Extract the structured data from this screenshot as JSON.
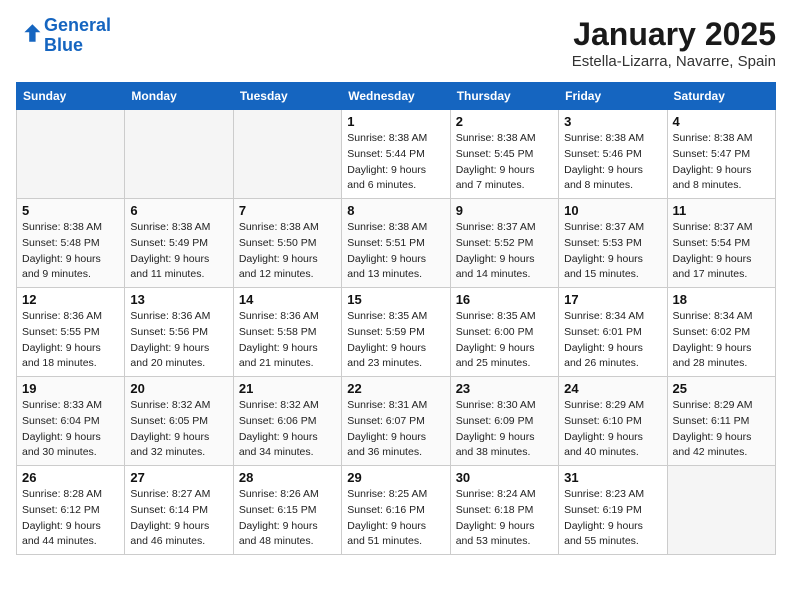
{
  "header": {
    "logo_line1": "General",
    "logo_line2": "Blue",
    "title": "January 2025",
    "subtitle": "Estella-Lizarra, Navarre, Spain"
  },
  "weekdays": [
    "Sunday",
    "Monday",
    "Tuesday",
    "Wednesday",
    "Thursday",
    "Friday",
    "Saturday"
  ],
  "weeks": [
    [
      {
        "day": "",
        "info": ""
      },
      {
        "day": "",
        "info": ""
      },
      {
        "day": "",
        "info": ""
      },
      {
        "day": "1",
        "info": "Sunrise: 8:38 AM\nSunset: 5:44 PM\nDaylight: 9 hours and 6 minutes."
      },
      {
        "day": "2",
        "info": "Sunrise: 8:38 AM\nSunset: 5:45 PM\nDaylight: 9 hours and 7 minutes."
      },
      {
        "day": "3",
        "info": "Sunrise: 8:38 AM\nSunset: 5:46 PM\nDaylight: 9 hours and 8 minutes."
      },
      {
        "day": "4",
        "info": "Sunrise: 8:38 AM\nSunset: 5:47 PM\nDaylight: 9 hours and 8 minutes."
      }
    ],
    [
      {
        "day": "5",
        "info": "Sunrise: 8:38 AM\nSunset: 5:48 PM\nDaylight: 9 hours and 9 minutes."
      },
      {
        "day": "6",
        "info": "Sunrise: 8:38 AM\nSunset: 5:49 PM\nDaylight: 9 hours and 11 minutes."
      },
      {
        "day": "7",
        "info": "Sunrise: 8:38 AM\nSunset: 5:50 PM\nDaylight: 9 hours and 12 minutes."
      },
      {
        "day": "8",
        "info": "Sunrise: 8:38 AM\nSunset: 5:51 PM\nDaylight: 9 hours and 13 minutes."
      },
      {
        "day": "9",
        "info": "Sunrise: 8:37 AM\nSunset: 5:52 PM\nDaylight: 9 hours and 14 minutes."
      },
      {
        "day": "10",
        "info": "Sunrise: 8:37 AM\nSunset: 5:53 PM\nDaylight: 9 hours and 15 minutes."
      },
      {
        "day": "11",
        "info": "Sunrise: 8:37 AM\nSunset: 5:54 PM\nDaylight: 9 hours and 17 minutes."
      }
    ],
    [
      {
        "day": "12",
        "info": "Sunrise: 8:36 AM\nSunset: 5:55 PM\nDaylight: 9 hours and 18 minutes."
      },
      {
        "day": "13",
        "info": "Sunrise: 8:36 AM\nSunset: 5:56 PM\nDaylight: 9 hours and 20 minutes."
      },
      {
        "day": "14",
        "info": "Sunrise: 8:36 AM\nSunset: 5:58 PM\nDaylight: 9 hours and 21 minutes."
      },
      {
        "day": "15",
        "info": "Sunrise: 8:35 AM\nSunset: 5:59 PM\nDaylight: 9 hours and 23 minutes."
      },
      {
        "day": "16",
        "info": "Sunrise: 8:35 AM\nSunset: 6:00 PM\nDaylight: 9 hours and 25 minutes."
      },
      {
        "day": "17",
        "info": "Sunrise: 8:34 AM\nSunset: 6:01 PM\nDaylight: 9 hours and 26 minutes."
      },
      {
        "day": "18",
        "info": "Sunrise: 8:34 AM\nSunset: 6:02 PM\nDaylight: 9 hours and 28 minutes."
      }
    ],
    [
      {
        "day": "19",
        "info": "Sunrise: 8:33 AM\nSunset: 6:04 PM\nDaylight: 9 hours and 30 minutes."
      },
      {
        "day": "20",
        "info": "Sunrise: 8:32 AM\nSunset: 6:05 PM\nDaylight: 9 hours and 32 minutes."
      },
      {
        "day": "21",
        "info": "Sunrise: 8:32 AM\nSunset: 6:06 PM\nDaylight: 9 hours and 34 minutes."
      },
      {
        "day": "22",
        "info": "Sunrise: 8:31 AM\nSunset: 6:07 PM\nDaylight: 9 hours and 36 minutes."
      },
      {
        "day": "23",
        "info": "Sunrise: 8:30 AM\nSunset: 6:09 PM\nDaylight: 9 hours and 38 minutes."
      },
      {
        "day": "24",
        "info": "Sunrise: 8:29 AM\nSunset: 6:10 PM\nDaylight: 9 hours and 40 minutes."
      },
      {
        "day": "25",
        "info": "Sunrise: 8:29 AM\nSunset: 6:11 PM\nDaylight: 9 hours and 42 minutes."
      }
    ],
    [
      {
        "day": "26",
        "info": "Sunrise: 8:28 AM\nSunset: 6:12 PM\nDaylight: 9 hours and 44 minutes."
      },
      {
        "day": "27",
        "info": "Sunrise: 8:27 AM\nSunset: 6:14 PM\nDaylight: 9 hours and 46 minutes."
      },
      {
        "day": "28",
        "info": "Sunrise: 8:26 AM\nSunset: 6:15 PM\nDaylight: 9 hours and 48 minutes."
      },
      {
        "day": "29",
        "info": "Sunrise: 8:25 AM\nSunset: 6:16 PM\nDaylight: 9 hours and 51 minutes."
      },
      {
        "day": "30",
        "info": "Sunrise: 8:24 AM\nSunset: 6:18 PM\nDaylight: 9 hours and 53 minutes."
      },
      {
        "day": "31",
        "info": "Sunrise: 8:23 AM\nSunset: 6:19 PM\nDaylight: 9 hours and 55 minutes."
      },
      {
        "day": "",
        "info": ""
      }
    ]
  ]
}
